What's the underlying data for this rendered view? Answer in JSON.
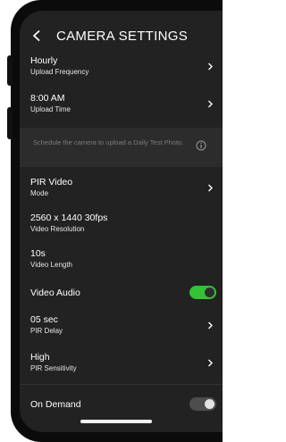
{
  "header": {
    "title": "CAMERA SETTINGS",
    "back_icon": "chevron-left-icon"
  },
  "settings": {
    "upload_frequency": {
      "value": "Hourly",
      "label": "Upload Frequency"
    },
    "upload_time": {
      "value": "8:00 AM",
      "label": "Upload Time"
    },
    "info": {
      "text": "Schedule the camera to upload a Daily Test Photo.",
      "icon": "info-icon"
    },
    "mode": {
      "value": "PIR Video",
      "label": "Mode"
    },
    "video_resolution": {
      "value": "2560 x 1440 30fps",
      "label": "Video Resolution"
    },
    "video_length": {
      "value": "10s",
      "label": "Video Length"
    },
    "video_audio": {
      "label": "Video Audio",
      "enabled": true
    },
    "pir_delay": {
      "value": "05 sec",
      "label": "PIR Delay"
    },
    "pir_sensitivity": {
      "value": "High",
      "label": "PIR Sensitivity"
    },
    "on_demand": {
      "label": "On Demand",
      "enabled": false
    }
  },
  "colors": {
    "background": "#222222",
    "toggle_on": "#34c234",
    "toggle_off": "#4d4d4d",
    "info_box": "#2c2c2c"
  }
}
